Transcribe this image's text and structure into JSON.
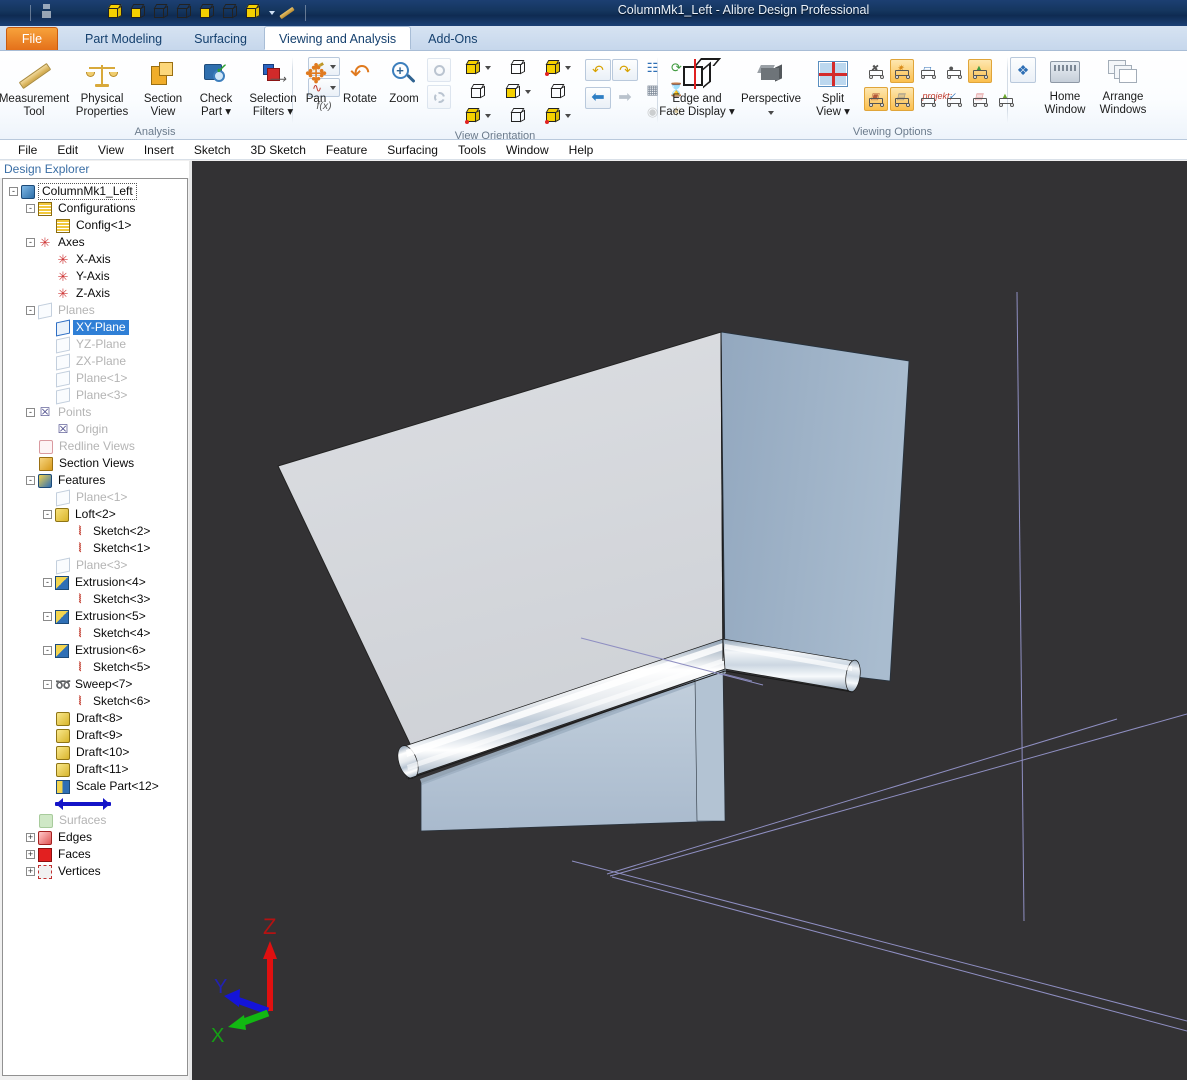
{
  "window": {
    "title": "ColumnMk1_Left - Alibre Design Professional"
  },
  "quick_access": {
    "icons": [
      "app-logo-icon",
      "save-icon",
      "undo-icon",
      "redo-icon",
      "view-iso-icon",
      "view-top-icon",
      "view-front-icon",
      "view-right-icon",
      "view-back-icon",
      "view-bottom-icon",
      "view-left-icon",
      "view-dropdown-icon",
      "measure-pencil-icon"
    ]
  },
  "tabs": [
    {
      "label": "File",
      "active": false,
      "kind": "file"
    },
    {
      "label": "Part Modeling",
      "active": false
    },
    {
      "label": "Surfacing",
      "active": false
    },
    {
      "label": "Viewing and Analysis",
      "active": true
    },
    {
      "label": "Add-Ons",
      "active": false
    }
  ],
  "ribbon": {
    "groups": [
      {
        "caption": "Analysis",
        "buttons": [
          {
            "label": "Measurement\nTool",
            "line1": "Measurement",
            "line2": "Tool",
            "icon": "ruler-icon"
          },
          {
            "label": "Physical Properties",
            "line1": "Physical",
            "line2": "Properties",
            "icon": "scales-icon"
          },
          {
            "label": "Section View",
            "line1": "Section",
            "line2": "View",
            "icon": "section-view-icon"
          },
          {
            "label": "Check Part",
            "line1": "Check",
            "line2": "Part",
            "icon": "check-part-icon",
            "dropdown": true
          },
          {
            "label": "Selection Filters",
            "line1": "Selection",
            "line2": "Filters",
            "icon": "selection-filters-icon",
            "dropdown": true
          }
        ],
        "small_stack_caption": "f(x)"
      },
      {
        "caption": "View Orientation",
        "buttons": [
          {
            "label": "Pan",
            "line1": "Pan",
            "line2": "",
            "icon": "pan-icon"
          },
          {
            "label": "Rotate",
            "line1": "Rotate",
            "line2": "",
            "icon": "rotate-icon"
          },
          {
            "label": "Zoom",
            "line1": "Zoom",
            "line2": "",
            "icon": "zoom-icon"
          }
        ]
      },
      {
        "caption": "Viewing Options",
        "buttons": [
          {
            "label": "Edge and Face Display",
            "line1": "Edge and",
            "line2": "Face Display",
            "icon": "edge-face-display-icon",
            "dropdown": true
          },
          {
            "label": "Perspective",
            "line1": "Perspective",
            "line2": "",
            "icon": "perspective-icon",
            "dropdown": true
          },
          {
            "label": "Split View",
            "line1": "Split",
            "line2": "View",
            "icon": "split-view-icon",
            "dropdown": true
          }
        ],
        "toggles_row1": [
          {
            "name": "hide-all-axes-toggle",
            "active": false
          },
          {
            "name": "show-axes-toggle",
            "active": true
          },
          {
            "name": "show-planes-toggle",
            "active": false
          },
          {
            "name": "show-points-toggle",
            "active": false
          },
          {
            "name": "show-sketches-toggle",
            "active": true
          }
        ],
        "toggles_row2": [
          {
            "name": "show-annotations-toggle",
            "active": true
          },
          {
            "name": "show-dims-toggle",
            "active": true
          },
          {
            "name": "show-section-toggle",
            "active": false
          },
          {
            "name": "show-curves-toggle",
            "active": false
          },
          {
            "name": "show-threads-toggle",
            "active": false
          },
          {
            "name": "show-surfaces-toggle",
            "active": false
          }
        ]
      },
      {
        "caption": "",
        "buttons": [
          {
            "label": "Home Window",
            "line1": "Home",
            "line2": "Window",
            "icon": "home-window-icon"
          },
          {
            "label": "Arrange Windows",
            "line1": "Arrange",
            "line2": "Windows",
            "icon": "arrange-windows-icon"
          }
        ]
      }
    ]
  },
  "menubar": {
    "items": [
      "File",
      "Edit",
      "View",
      "Insert",
      "Sketch",
      "3D Sketch",
      "Feature",
      "Surfacing",
      "Tools",
      "Window",
      "Help"
    ]
  },
  "design_explorer": {
    "header": "Design Explorer",
    "tree": [
      {
        "label": "ColumnMk1_Left",
        "depth": 0,
        "icon": "part-icon",
        "expander": "-",
        "state": "root"
      },
      {
        "label": "Configurations",
        "depth": 1,
        "icon": "configurations-icon",
        "expander": "-"
      },
      {
        "label": "Config<1>",
        "depth": 2,
        "icon": "configuration-icon",
        "expander": ""
      },
      {
        "label": "Axes",
        "depth": 1,
        "icon": "axes-icon",
        "expander": "-"
      },
      {
        "label": "X-Axis",
        "depth": 2,
        "icon": "axis-icon",
        "expander": ""
      },
      {
        "label": "Y-Axis",
        "depth": 2,
        "icon": "axis-icon",
        "expander": ""
      },
      {
        "label": "Z-Axis",
        "depth": 2,
        "icon": "axis-icon",
        "expander": ""
      },
      {
        "label": "Planes",
        "depth": 1,
        "icon": "plane-icon",
        "expander": "-",
        "state": "dim"
      },
      {
        "label": "XY-Plane",
        "depth": 2,
        "icon": "plane-icon",
        "expander": "",
        "state": "selected"
      },
      {
        "label": "YZ-Plane",
        "depth": 2,
        "icon": "plane-icon",
        "expander": "",
        "state": "dim"
      },
      {
        "label": "ZX-Plane",
        "depth": 2,
        "icon": "plane-icon",
        "expander": "",
        "state": "dim"
      },
      {
        "label": "Plane<1>",
        "depth": 2,
        "icon": "plane-icon",
        "expander": "",
        "state": "dim"
      },
      {
        "label": "Plane<3>",
        "depth": 2,
        "icon": "plane-icon",
        "expander": "",
        "state": "dim"
      },
      {
        "label": "Points",
        "depth": 1,
        "icon": "points-icon",
        "expander": "-",
        "state": "dim"
      },
      {
        "label": "Origin",
        "depth": 2,
        "icon": "point-icon",
        "expander": "",
        "state": "dim"
      },
      {
        "label": "Redline Views",
        "depth": 1,
        "icon": "redline-views-icon",
        "expander": "",
        "state": "dim"
      },
      {
        "label": "Section Views",
        "depth": 1,
        "icon": "section-views-icon",
        "expander": ""
      },
      {
        "label": "Features",
        "depth": 1,
        "icon": "features-icon",
        "expander": "-"
      },
      {
        "label": "Plane<1>",
        "depth": 2,
        "icon": "plane-icon",
        "expander": "",
        "state": "dim"
      },
      {
        "label": "Loft<2>",
        "depth": 2,
        "icon": "loft-icon",
        "expander": "-"
      },
      {
        "label": "Sketch<2>",
        "depth": 3,
        "icon": "sketch-icon",
        "expander": ""
      },
      {
        "label": "Sketch<1>",
        "depth": 3,
        "icon": "sketch-icon",
        "expander": ""
      },
      {
        "label": "Plane<3>",
        "depth": 2,
        "icon": "plane-icon",
        "expander": "",
        "state": "dim"
      },
      {
        "label": "Extrusion<4>",
        "depth": 2,
        "icon": "extrusion-icon",
        "expander": "-"
      },
      {
        "label": "Sketch<3>",
        "depth": 3,
        "icon": "sketch-icon",
        "expander": ""
      },
      {
        "label": "Extrusion<5>",
        "depth": 2,
        "icon": "extrusion-icon",
        "expander": "-"
      },
      {
        "label": "Sketch<4>",
        "depth": 3,
        "icon": "sketch-icon",
        "expander": ""
      },
      {
        "label": "Extrusion<6>",
        "depth": 2,
        "icon": "extrusion-icon",
        "expander": "-"
      },
      {
        "label": "Sketch<5>",
        "depth": 3,
        "icon": "sketch-icon",
        "expander": ""
      },
      {
        "label": "Sweep<7>",
        "depth": 2,
        "icon": "sweep-icon",
        "expander": "-"
      },
      {
        "label": "Sketch<6>",
        "depth": 3,
        "icon": "sketch-icon",
        "expander": ""
      },
      {
        "label": "Draft<8>",
        "depth": 2,
        "icon": "draft-icon",
        "expander": ""
      },
      {
        "label": "Draft<9>",
        "depth": 2,
        "icon": "draft-icon",
        "expander": ""
      },
      {
        "label": "Draft<10>",
        "depth": 2,
        "icon": "draft-icon",
        "expander": ""
      },
      {
        "label": "Draft<11>",
        "depth": 2,
        "icon": "draft-icon",
        "expander": ""
      },
      {
        "label": "Scale Part<12>",
        "depth": 2,
        "icon": "scale-part-icon",
        "expander": ""
      },
      {
        "label": "__ROLLBACK__",
        "depth": 2,
        "icon": "rollback-bar",
        "expander": ""
      },
      {
        "label": "Surfaces",
        "depth": 1,
        "icon": "surfaces-icon",
        "expander": "",
        "state": "dim"
      },
      {
        "label": "Edges",
        "depth": 1,
        "icon": "edges-icon",
        "expander": "+"
      },
      {
        "label": "Faces",
        "depth": 1,
        "icon": "faces-icon",
        "expander": "+"
      },
      {
        "label": "Vertices",
        "depth": 1,
        "icon": "vertices-icon",
        "expander": "+"
      }
    ]
  },
  "viewport": {
    "background_color": "#333234",
    "axis_line_color": "#8f8fc2",
    "model_face_light": "#d8dade",
    "model_face_mid": "#aebfd2",
    "model_face_dark": "#97aabf",
    "model_edge_color": "#1a1a1a",
    "triad": {
      "z_label": "Z",
      "z_color": "#e01010",
      "y_label": "Y",
      "y_color": "#1414d8",
      "x_label": "X",
      "x_color": "#12b812"
    }
  }
}
